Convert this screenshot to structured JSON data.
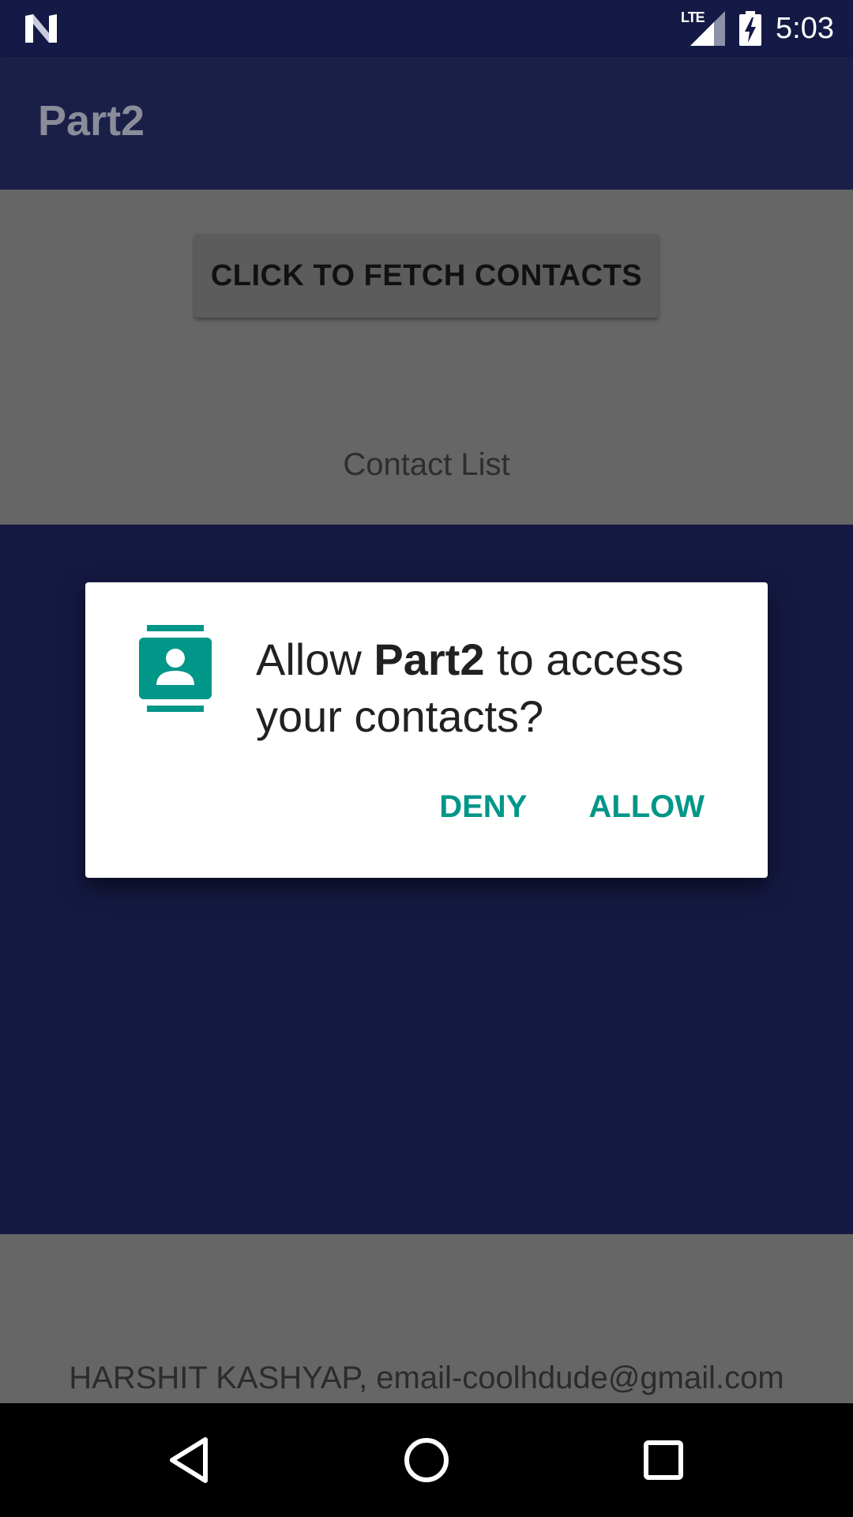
{
  "status_bar": {
    "network": "LTE",
    "time": "5:03",
    "icons": [
      "n-notification-icon",
      "lte-signal-icon",
      "battery-charging-icon"
    ]
  },
  "app_bar": {
    "title": "Part2"
  },
  "main": {
    "fetch_button_label": "CLICK TO FETCH CONTACTS",
    "contact_list_label": "Contact List"
  },
  "footer": {
    "text": "HARSHIT KASHYAP, email-coolhdude@gmail.com"
  },
  "dialog": {
    "icon": "contacts-icon",
    "message_prefix": "Allow ",
    "app_name": "Part2",
    "message_suffix": " to access your contacts?",
    "deny_label": "DENY",
    "allow_label": "ALLOW"
  },
  "nav_bar": {
    "icons": [
      "back-icon",
      "home-icon",
      "recents-icon"
    ]
  },
  "colors": {
    "accent": "#009688",
    "status_bar": "#141a45",
    "app_bar": "#1a1f48",
    "list_area": "#151942",
    "scrim_background": "#666666"
  }
}
